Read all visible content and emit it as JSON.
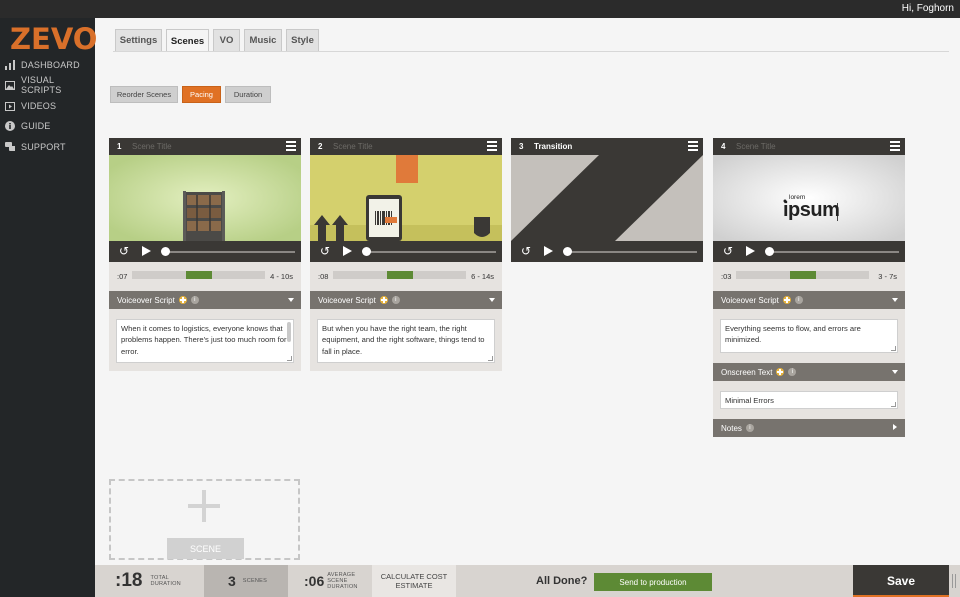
{
  "topbar": {
    "greeting": "Hi, Foghorn"
  },
  "brand": {
    "logo": "ZEVO",
    "accent": "#e07124"
  },
  "sidebar": {
    "items": [
      {
        "label": "DASHBOARD",
        "icon": "bar-chart-icon"
      },
      {
        "label": "VISUAL SCRIPTS",
        "icon": "image-icon"
      },
      {
        "label": "VIDEOS",
        "icon": "video-icon"
      },
      {
        "label": "GUIDE",
        "icon": "info-icon"
      },
      {
        "label": "SUPPORT",
        "icon": "chat-icon"
      }
    ]
  },
  "tabs": [
    {
      "label": "Settings",
      "active": false
    },
    {
      "label": "Scenes",
      "active": true
    },
    {
      "label": "VO",
      "active": false
    },
    {
      "label": "Music",
      "active": false
    },
    {
      "label": "Style",
      "active": false
    }
  ],
  "subtabs": [
    {
      "label": "Reorder Scenes",
      "active": false
    },
    {
      "label": "Pacing",
      "active": true
    },
    {
      "label": "Duration",
      "active": false
    }
  ],
  "scenes": [
    {
      "number": "1",
      "title": "Scene Title",
      "title_is_placeholder": true,
      "time": ":07",
      "range": "4 - 10s",
      "pace_fraction": 0.5,
      "voiceover_label": "Voiceover Script",
      "voiceover_text": "When it comes to logistics, everyone knows that problems happen. There's just too much room for error."
    },
    {
      "number": "2",
      "title": "Scene Title",
      "title_is_placeholder": true,
      "time": ":08",
      "range": "6 - 14s",
      "pace_fraction": 0.5,
      "voiceover_label": "Voiceover Script",
      "voiceover_text": "But when you have the right team, the right equipment, and the right software, things tend to fall in place."
    },
    {
      "number": "3",
      "title": "Transition",
      "title_is_placeholder": false
    },
    {
      "number": "4",
      "title": "Scene Title",
      "title_is_placeholder": true,
      "time": ":03",
      "range": "3 - 7s",
      "pace_fraction": 0.5,
      "voiceover_label": "Voiceover Script",
      "voiceover_text": "Everything seems to flow, and errors are minimized.",
      "onscreen_label": "Onscreen Text",
      "onscreen_text": "Minimal Errors",
      "notes_label": "Notes",
      "thumb_small": "lorem",
      "thumb_big": "ipsum"
    }
  ],
  "add_scene": {
    "label": "SCENE"
  },
  "footer": {
    "total_duration": ":18",
    "total_duration_label_1": "TOTAL",
    "total_duration_label_2": "DURATION",
    "scenes_count": "3",
    "scenes_label": "SCENES",
    "avg_duration": ":06",
    "avg_label_1": "AVERAGE",
    "avg_label_2": "SCENE",
    "avg_label_3": "DURATION",
    "calc_1": "CALCULATE COST",
    "calc_2": "ESTIMATE",
    "all_done": "All Done?",
    "send_label": "Send to production",
    "save_label": "Save"
  }
}
